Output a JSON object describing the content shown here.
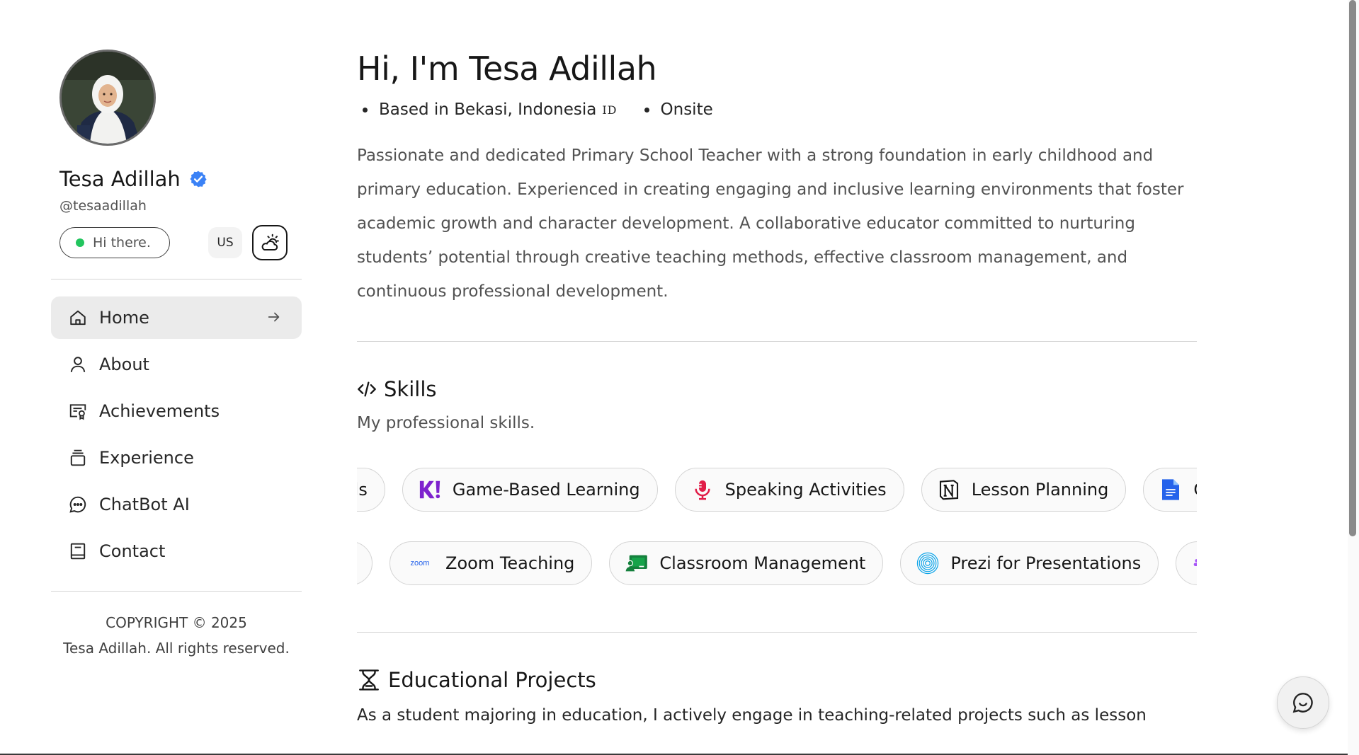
{
  "profile": {
    "name": "Tesa Adillah",
    "handle": "@tesaadillah",
    "status": "Hi there.",
    "language": "US"
  },
  "nav": {
    "items": [
      {
        "label": "Home",
        "icon": "home-icon",
        "active": true
      },
      {
        "label": "About",
        "icon": "user-icon"
      },
      {
        "label": "Achievements",
        "icon": "certificate-icon"
      },
      {
        "label": "Experience",
        "icon": "briefcase-stack-icon"
      },
      {
        "label": "ChatBot AI",
        "icon": "chat-bubble-icon"
      },
      {
        "label": "Contact",
        "icon": "book-icon"
      }
    ]
  },
  "footer": {
    "copyright_line1": "COPYRIGHT © 2025",
    "copyright_line2": "Tesa Adillah. All rights reserved."
  },
  "hero": {
    "title": "Hi, I'm Tesa Adillah",
    "location": "Based in Bekasi, Indonesia",
    "flag": "ID",
    "work_mode": "Onsite",
    "bio": "Passionate and dedicated Primary School Teacher with a strong foundation in early childhood and primary education. Experienced in creating engaging and inclusive learning environments that foster academic growth and character development. A collaborative educator committed to nurturing students’ potential through creative teaching methods, effective classroom management, and continuous professional development."
  },
  "skills": {
    "title": "Skills",
    "subtitle": "My professional skills.",
    "row1": [
      "ols",
      "Game-Based Learning",
      "Speaking Activities",
      "Lesson Planning",
      "Gc"
    ],
    "row2": [
      "",
      "Zoom Teaching",
      "Classroom Management",
      "Prezi for Presentations",
      "S"
    ],
    "icons": {
      "game_based": "kahoot-icon",
      "speaking": "microphone-icon",
      "lesson": "notion-icon",
      "docs": "google-docs-icon",
      "zoom": "zoom-icon",
      "classroom": "google-classroom-icon",
      "prezi": "prezi-icon",
      "slack": "slack-icon"
    },
    "colors": {
      "kahoot": "#7e22ce",
      "mic": "#e11d48",
      "docs": "#2563eb",
      "classroom": "#15803d",
      "prezi": "#0ea5e9",
      "slack": "#a855f7"
    }
  },
  "projects": {
    "title": "Educational Projects",
    "text": "As a student majoring in education, I actively engage in teaching-related projects such as lesson"
  },
  "colors": {
    "status_dot": "#22c55e",
    "verified": "#3b82f6",
    "active_nav_bg": "#ebebeb"
  }
}
